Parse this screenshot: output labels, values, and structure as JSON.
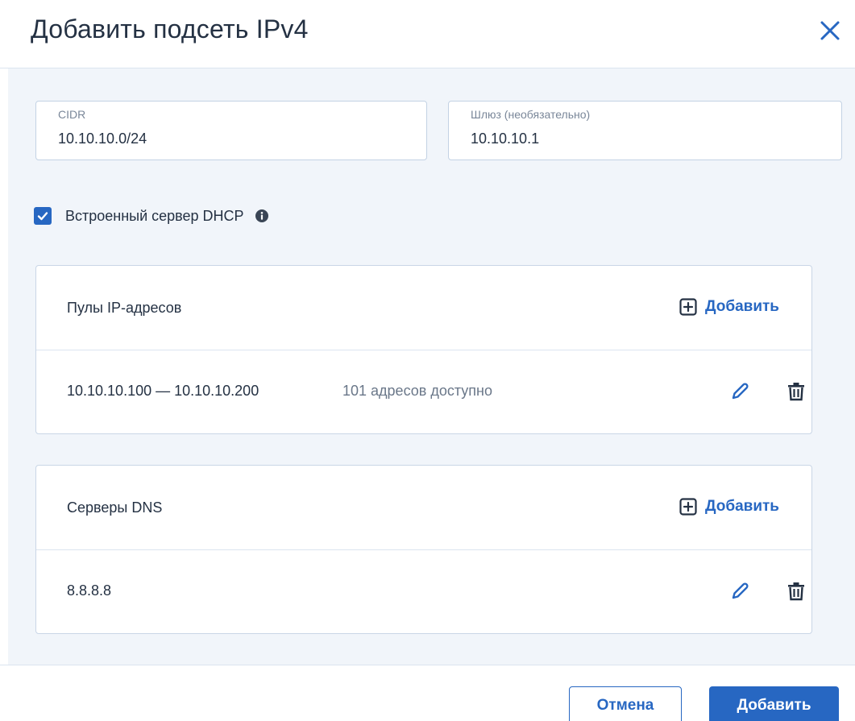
{
  "dialog": {
    "title": "Добавить подсеть IPv4"
  },
  "fields": {
    "cidr": {
      "label": "CIDR",
      "value": "10.10.10.0/24"
    },
    "gateway": {
      "label": "Шлюз (необязательно)",
      "value": "10.10.10.1"
    }
  },
  "dhcp": {
    "label": "Встроенный сервер DHCP",
    "checked": true
  },
  "ip_pools": {
    "title": "Пулы IP-адресов",
    "add_label": "Добавить",
    "items": [
      {
        "range": "10.10.10.100 — 10.10.10.200",
        "available": "101 адресов доступно"
      }
    ]
  },
  "dns_servers": {
    "title": "Серверы DNS",
    "add_label": "Добавить",
    "items": [
      {
        "address": "8.8.8.8"
      }
    ]
  },
  "footer": {
    "cancel_label": "Отмена",
    "add_label": "Добавить"
  },
  "colors": {
    "accent": "#2767c2",
    "text": "#243143",
    "muted": "#6a7789",
    "body_bg": "#f1f5fa",
    "border": "#c9d6e6"
  },
  "icons": {
    "close": "close-icon",
    "checkbox": "checkmark-icon",
    "info": "info-icon",
    "add": "plus-square-icon",
    "edit": "pencil-icon",
    "delete": "trash-icon"
  }
}
